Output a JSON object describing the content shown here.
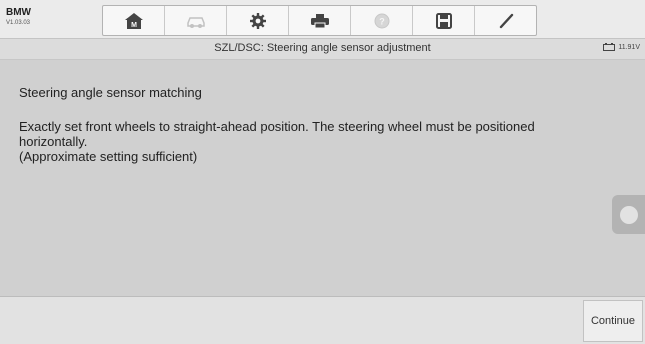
{
  "header": {
    "brand": "BMW",
    "version": "V1.03.03"
  },
  "toolbar": {
    "buttons": [
      {
        "icon": "home-icon"
      },
      {
        "icon": "vehicle-swap-icon"
      },
      {
        "icon": "gear-icon"
      },
      {
        "icon": "printer-icon"
      },
      {
        "icon": "help-icon"
      },
      {
        "icon": "save-icon"
      },
      {
        "icon": "pen-icon"
      }
    ]
  },
  "subheader": {
    "title": "SZL/DSC: Steering angle sensor adjustment",
    "battery": "11.91V"
  },
  "message": {
    "title": "Steering angle sensor matching",
    "line1": "Exactly set front wheels to straight-ahead position. The steering wheel must be positioned horizontally.",
    "line2": "(Approximate setting sufficient)"
  },
  "footer": {
    "continue_label": "Continue"
  },
  "colors": {
    "background": "#d0d0d0",
    "toolbar_bg": "#f7f7f7",
    "text": "#222222"
  }
}
